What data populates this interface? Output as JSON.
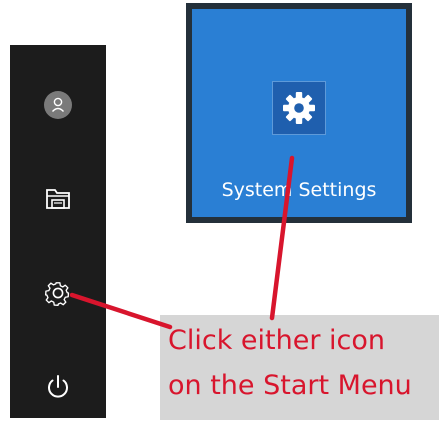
{
  "start_sidebar": {
    "items": [
      {
        "icon": "user-avatar-icon"
      },
      {
        "icon": "file-explorer-icon"
      },
      {
        "icon": "settings-gear-icon"
      },
      {
        "icon": "power-icon"
      }
    ],
    "background": "#1c1c1c",
    "icon_color": "#ffffff",
    "avatar_circle_color": "#7a7a7a"
  },
  "settings_tile": {
    "label": "System Settings",
    "icon": "gear-icon",
    "tile_color": "#2a7fd4",
    "icon_box_color": "#1f5fae",
    "frame_color": "#24303a"
  },
  "annotation": {
    "line1": "Click either icon",
    "line2": "on the Start Menu",
    "text_color": "#d8152d",
    "background": "#d6d6d6",
    "arrow_color": "#d8152d"
  }
}
